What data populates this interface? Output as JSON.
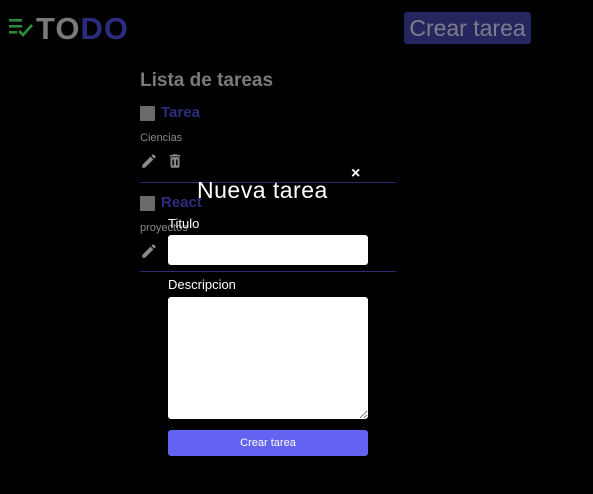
{
  "header": {
    "logo_to": "TO",
    "logo_do": "DO",
    "create_button": "Crear tarea"
  },
  "list": {
    "title": "Lista de tareas",
    "tasks": [
      {
        "title": "Tarea",
        "category": "Ciencias"
      },
      {
        "title": "React",
        "category": "proyectos"
      }
    ]
  },
  "modal": {
    "title": "Nueva tarea",
    "close": "×",
    "title_label": "Titulo",
    "title_value": "",
    "description_label": "Descripcion",
    "description_value": "",
    "submit": "Crear tarea"
  },
  "colors": {
    "background": "#000000",
    "accent": "#6363f1",
    "logo_green": "#2a8a3a",
    "task_title": "#2c2c7e"
  },
  "icons": [
    "playlist-check-icon",
    "pencil-icon",
    "trash-icon",
    "close-icon"
  ]
}
